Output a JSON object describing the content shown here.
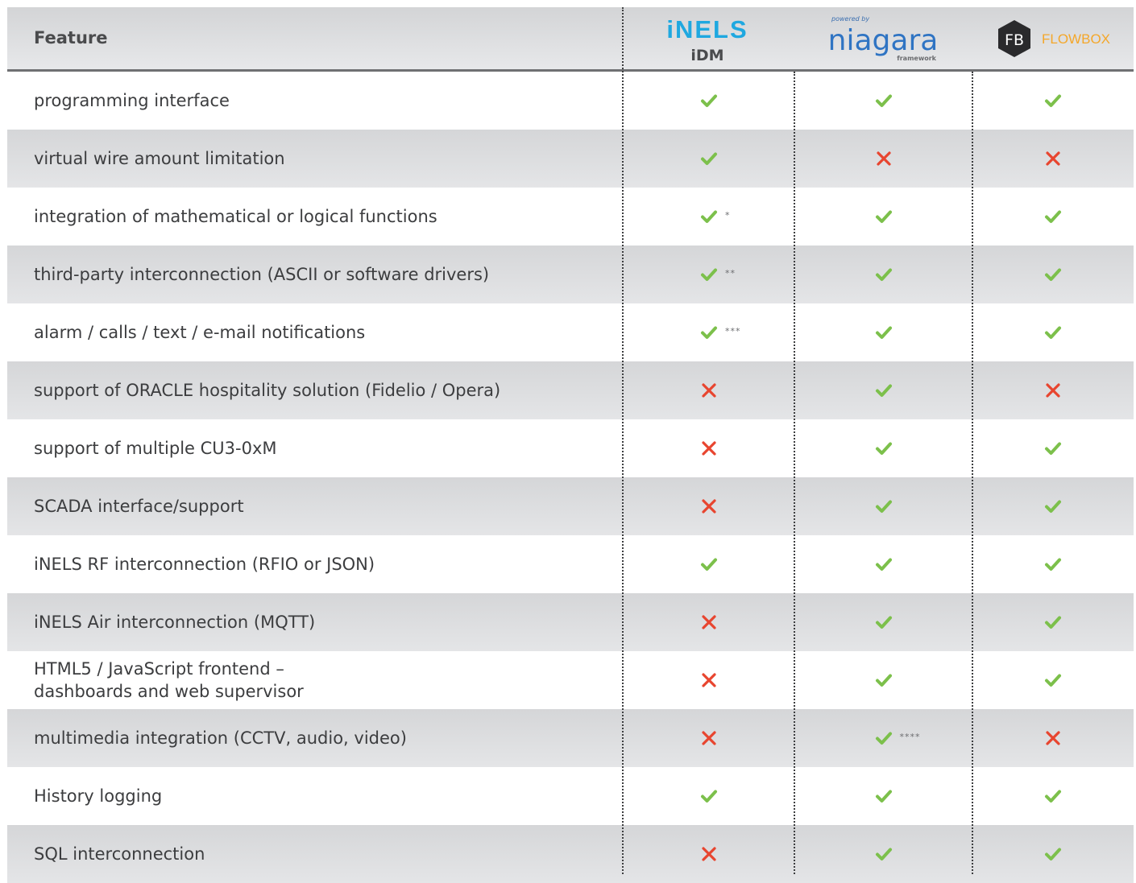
{
  "header": {
    "feature_label": "Feature",
    "columns": [
      {
        "brand": "iNELS",
        "sub": "iDM"
      },
      {
        "powered": "powered by",
        "brand": "niagara",
        "sub": "framework"
      },
      {
        "badge": "FB",
        "brand": "FLOWBOX"
      }
    ]
  },
  "colors": {
    "check": "#7cc04b",
    "cross": "#e8452f",
    "inels": "#1fa8e0",
    "flowbox": "#f4a72a"
  },
  "rows": [
    {
      "label": "programming interface",
      "values": [
        "yes",
        "yes",
        "yes"
      ],
      "notes": [
        "",
        "",
        ""
      ]
    },
    {
      "label": "virtual wire amount limitation",
      "values": [
        "yes",
        "no",
        "no"
      ],
      "notes": [
        "",
        "",
        ""
      ]
    },
    {
      "label": "integration of mathematical or logical functions",
      "values": [
        "yes",
        "yes",
        "yes"
      ],
      "notes": [
        "*",
        "",
        ""
      ]
    },
    {
      "label": "third-party interconnection (ASCII or software drivers)",
      "values": [
        "yes",
        "yes",
        "yes"
      ],
      "notes": [
        "**",
        "",
        ""
      ]
    },
    {
      "label": "alarm / calls / text / e-mail notifications",
      "values": [
        "yes",
        "yes",
        "yes"
      ],
      "notes": [
        "***",
        "",
        ""
      ]
    },
    {
      "label": "support of ORACLE hospitality solution (Fidelio / Opera)",
      "values": [
        "no",
        "yes",
        "no"
      ],
      "notes": [
        "",
        "",
        ""
      ]
    },
    {
      "label": "support of multiple CU3-0xM",
      "values": [
        "no",
        "yes",
        "yes"
      ],
      "notes": [
        "",
        "",
        ""
      ]
    },
    {
      "label": "SCADA interface/support",
      "values": [
        "no",
        "yes",
        "yes"
      ],
      "notes": [
        "",
        "",
        ""
      ]
    },
    {
      "label": "iNELS RF interconnection (RFIO or JSON)",
      "values": [
        "yes",
        "yes",
        "yes"
      ],
      "notes": [
        "",
        "",
        ""
      ]
    },
    {
      "label": "iNELS Air interconnection (MQTT)",
      "values": [
        "no",
        "yes",
        "yes"
      ],
      "notes": [
        "",
        "",
        ""
      ]
    },
    {
      "label": "HTML5 / JavaScript frontend –\ndashboards and web supervisor",
      "values": [
        "no",
        "yes",
        "yes"
      ],
      "notes": [
        "",
        "",
        ""
      ]
    },
    {
      "label": "multimedia integration (CCTV, audio, video)",
      "values": [
        "no",
        "yes",
        "no"
      ],
      "notes": [
        "",
        "****",
        ""
      ]
    },
    {
      "label": "History logging",
      "values": [
        "yes",
        "yes",
        "yes"
      ],
      "notes": [
        "",
        "",
        ""
      ]
    },
    {
      "label": "SQL interconnection",
      "values": [
        "no",
        "yes",
        "yes"
      ],
      "notes": [
        "",
        "",
        ""
      ]
    }
  ]
}
